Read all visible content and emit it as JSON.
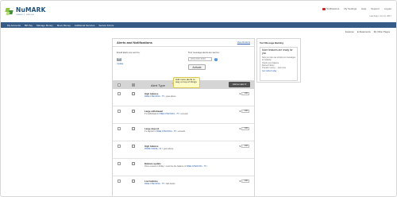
{
  "brand": {
    "name": "NuMARK",
    "subtitle": "CREDIT UNION"
  },
  "header": {
    "links": [
      "Notifications",
      "My Settings",
      "Help",
      "Support",
      "Logout"
    ],
    "last_login": "Last login: Jun 12, 2017"
  },
  "nav": {
    "items": [
      "My Accounts",
      "Bill Pay",
      "Manage Money",
      "Move Money",
      "Additional Services",
      "Secure Forms"
    ]
  },
  "subnav": {
    "items": [
      "Features",
      "E-Statements",
      "My Other Pages"
    ]
  },
  "main": {
    "title": "Alerts and Notifications",
    "view_link": "View All Alerts",
    "email_label": "Email alerts are sent to:",
    "update_link": "Update",
    "text_label": "Text message alerts are sent to:",
    "phone_placeholder": "(XXX) XXX-XXXX",
    "help_symbol": "?",
    "activate_label": "Activate",
    "table_header_label": "Alert Type",
    "add_alert_label": "Add an alert ▾"
  },
  "tooltip": {
    "text": "Add more alerts to stay on top of things"
  },
  "alerts": [
    {
      "title": "High balance",
      "desc_prefix": "",
      "account": "FREE CHECKING - 75",
      "desc_suffix": " > goes above",
      "currency": "$",
      "amount": "100"
    },
    {
      "title": "Large withdrawal",
      "desc_prefix": "If a withdrawal in ",
      "account": "FREE CHECKING - 75",
      "desc_suffix": " > exceeds",
      "currency": "$",
      "amount": "100"
    },
    {
      "title": "Large deposit",
      "desc_prefix": "If a deposit in ",
      "account": "FREE CHECKING - 75",
      "desc_suffix": " > exceeds",
      "currency": "$",
      "amount": "100"
    },
    {
      "title": "High balance",
      "desc_prefix": "",
      "account": "PRIME SHARE - 01",
      "desc_suffix": " > goes above",
      "currency": "$",
      "amount": "100"
    },
    {
      "title": "Balance update",
      "desc_prefix": "Once a week on Friday > send me the balance of ",
      "account": "FREE CHECKING - 75",
      "desc_suffix": " >",
      "currency": "",
      "amount": ""
    },
    {
      "title": "Low balance",
      "desc_prefix": "",
      "account": "FREE CHECKING - 75",
      "desc_suffix": " > falls below",
      "currency": "$",
      "amount": "100"
    }
  ],
  "side": {
    "title": "Text Message Banking",
    "heading": "More features are ready for you",
    "text": "Now you can use simple text messages to instantly:",
    "list": [
      "Check your balance",
      "Review history",
      "Transfer money ... and more"
    ],
    "link": "Get started today"
  },
  "colors": {
    "navbar": "#355b86",
    "brand_green": "#8dc63f",
    "link": "#2b5ea8",
    "tooltip_bg": "#fffbc7"
  }
}
